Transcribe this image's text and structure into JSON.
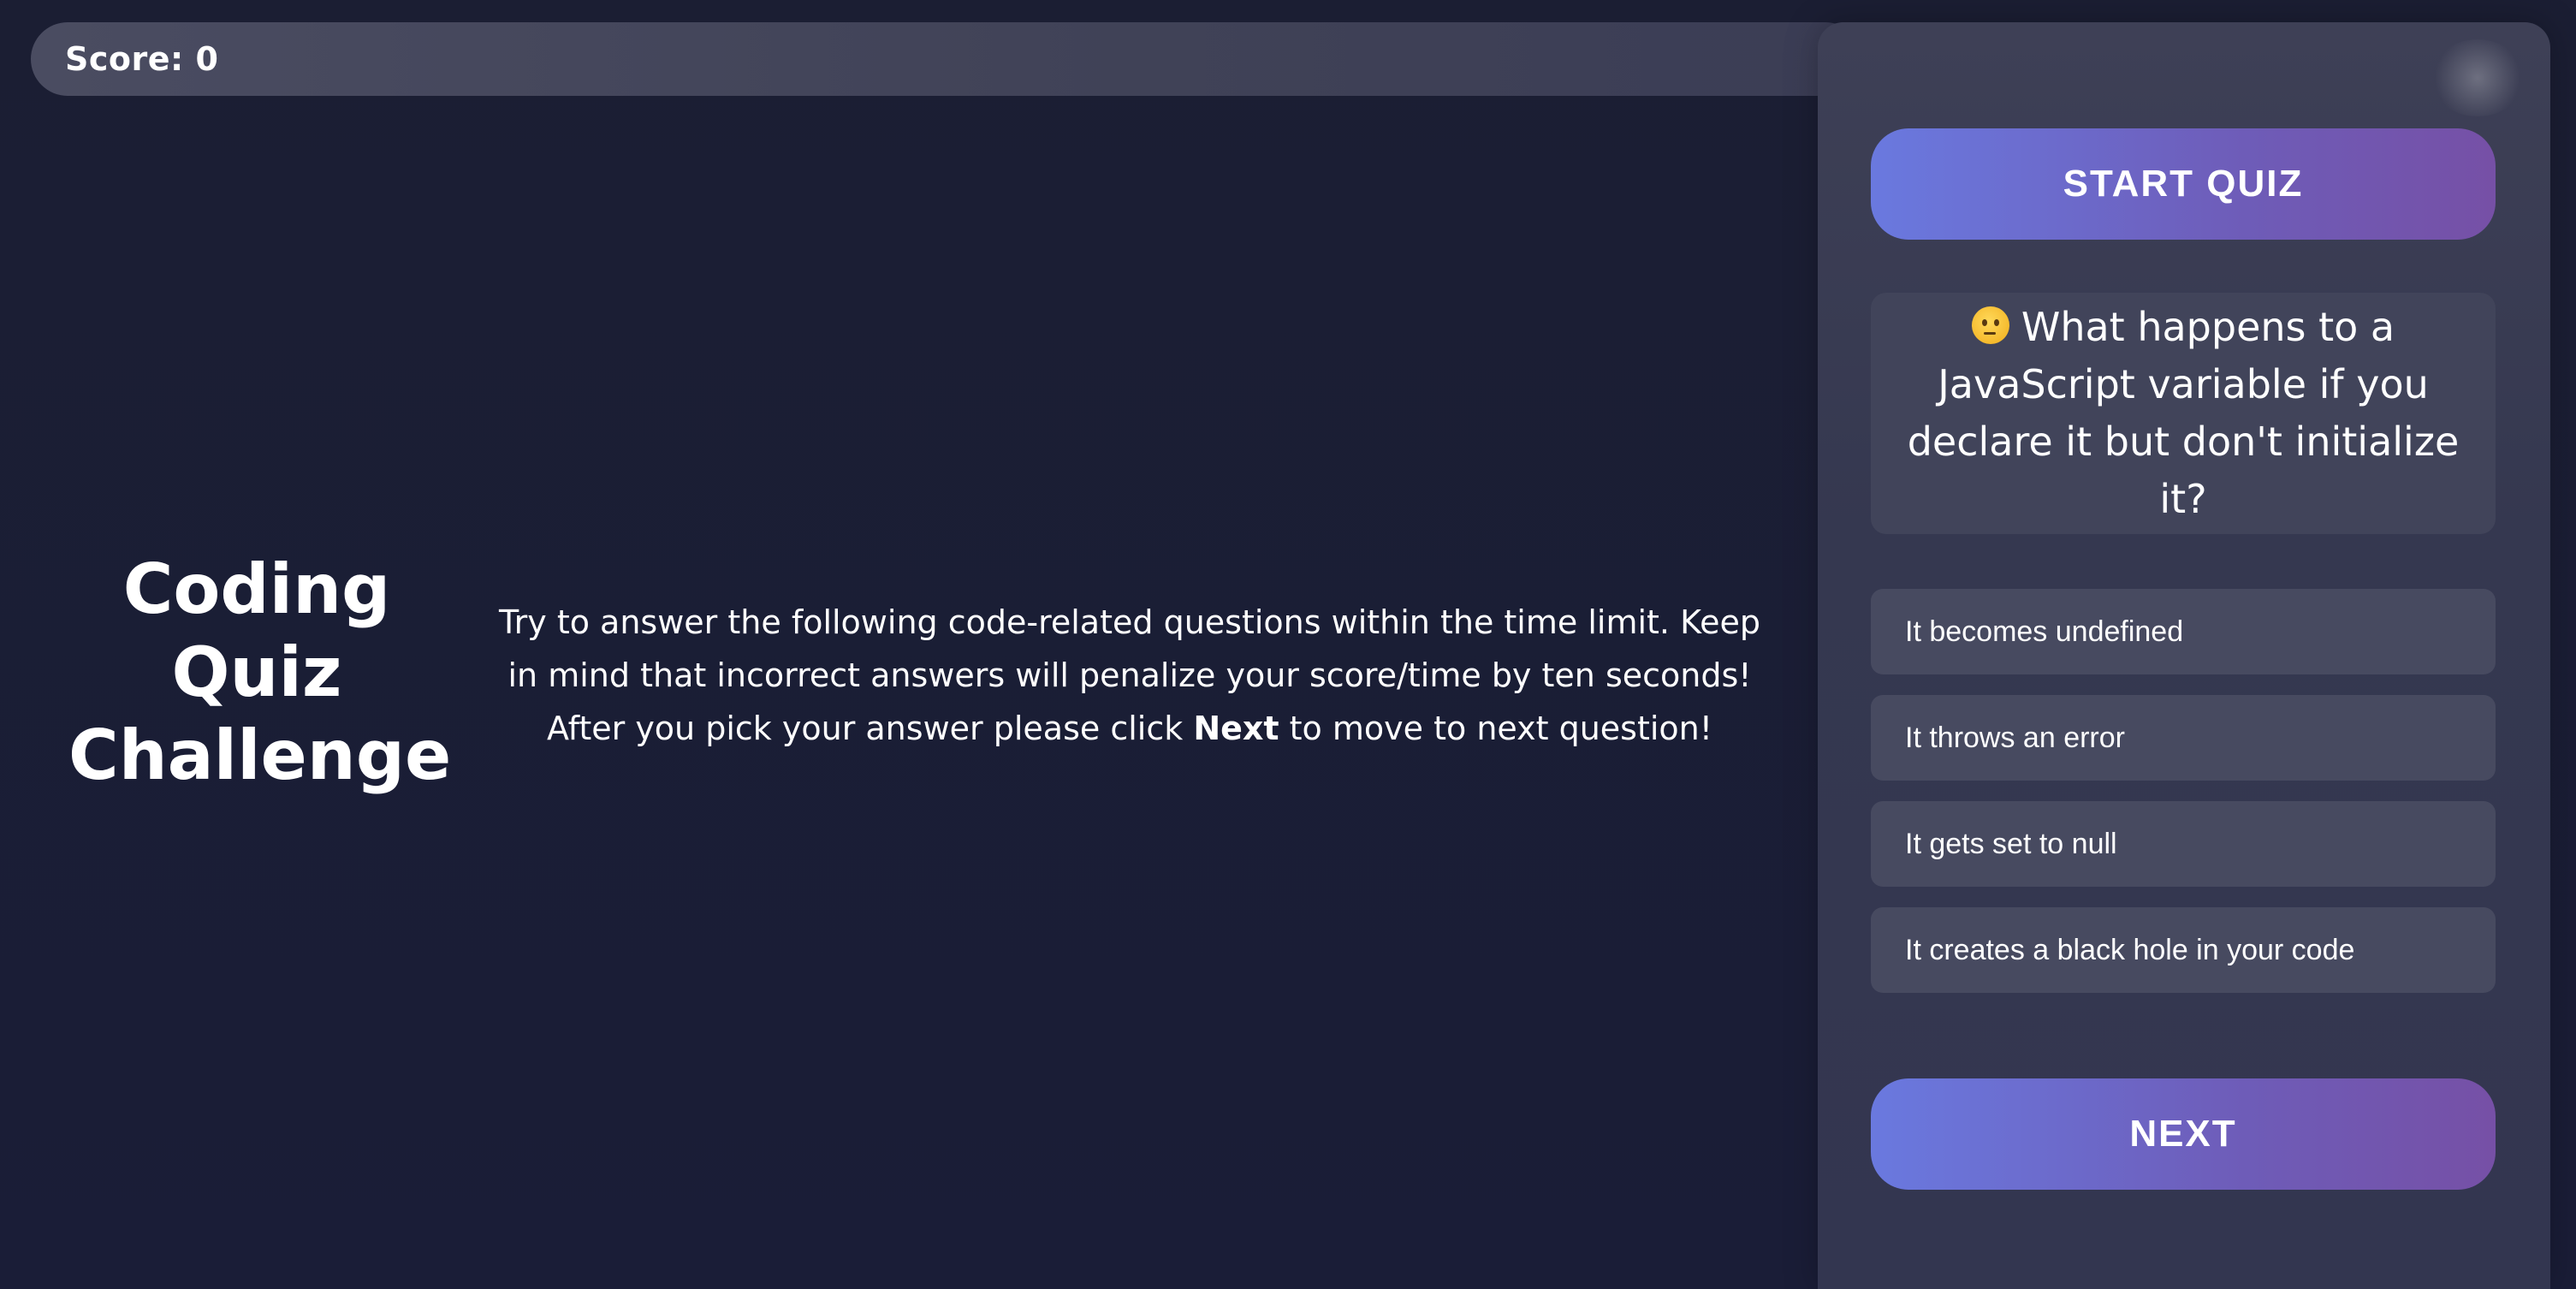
{
  "score": {
    "label": "Score: 0"
  },
  "title": {
    "line1": "Coding",
    "line2": "Quiz",
    "line3": "Challenge"
  },
  "instructions": {
    "text_before": "Try to answer the following code-related questions within the time limit. Keep in mind that incorrect answers will penalize your score/time by ten seconds! After you pick your answer please click ",
    "bold_word": "Next",
    "text_after": " to move to next question!"
  },
  "panel": {
    "start_button_label": "START QUIZ",
    "question": {
      "icon": "thinking-face-icon",
      "text": "What happens to a JavaScript variable if you declare it but don't initialize it?"
    },
    "answers": [
      "It becomes undefined",
      "It throws an error",
      "It gets set to null",
      "It creates a black hole in your code"
    ],
    "next_button_label": "NEXT"
  },
  "colors": {
    "background": "#1b1e33",
    "panel": "#353850",
    "button_gradient_start": "#6a79df",
    "button_gradient_end": "#7650a6",
    "answer_bg": "#474a60"
  }
}
